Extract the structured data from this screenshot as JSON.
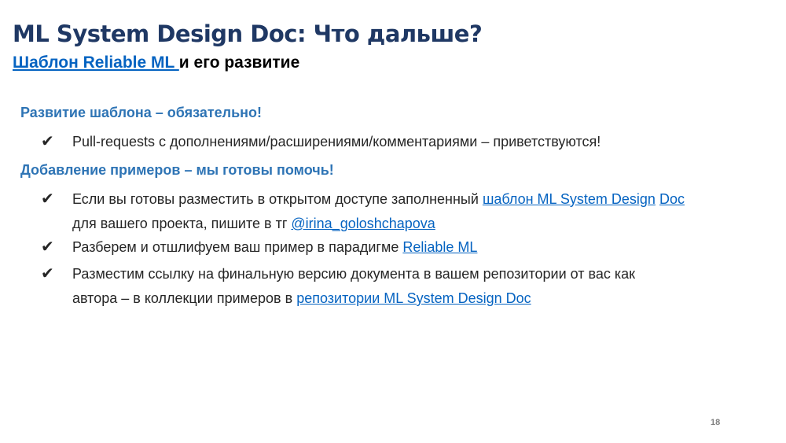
{
  "title": "ML System Design Doc: Что дальше?",
  "subtitle": {
    "link_text": "Шаблон Reliable ML ",
    "rest": "и его развитие"
  },
  "sections": [
    {
      "heading": "Развитие шаблона – обязательно!",
      "items": [
        {
          "text": "Pull-requests с дополнениями/расширениями/комментариями – приветствуются!"
        }
      ]
    },
    {
      "heading": "Добавление примеров – мы готовы помочь!",
      "items": [
        {
          "text_before": "Если вы готовы разместить в открытом доступе заполненный ",
          "link1": "шаблон ML System Design",
          "space": " ",
          "link2": "Doc",
          "line2_text": "для вашего проекта, пишите в тг ",
          "link3": "@irina_goloshchapova"
        },
        {
          "text_before": "Разберем и отшлифуем ваш пример в парадигме ",
          "link1": "Reliable ML"
        },
        {
          "line1": "Разместим ссылку на финальную версию документа в вашем репозитории от вас как",
          "line2_text": "автора – в коллекции примеров в ",
          "link1": "репозитории ML System Design Doc"
        }
      ]
    }
  ],
  "check_icon": "✔",
  "page_number": "18"
}
